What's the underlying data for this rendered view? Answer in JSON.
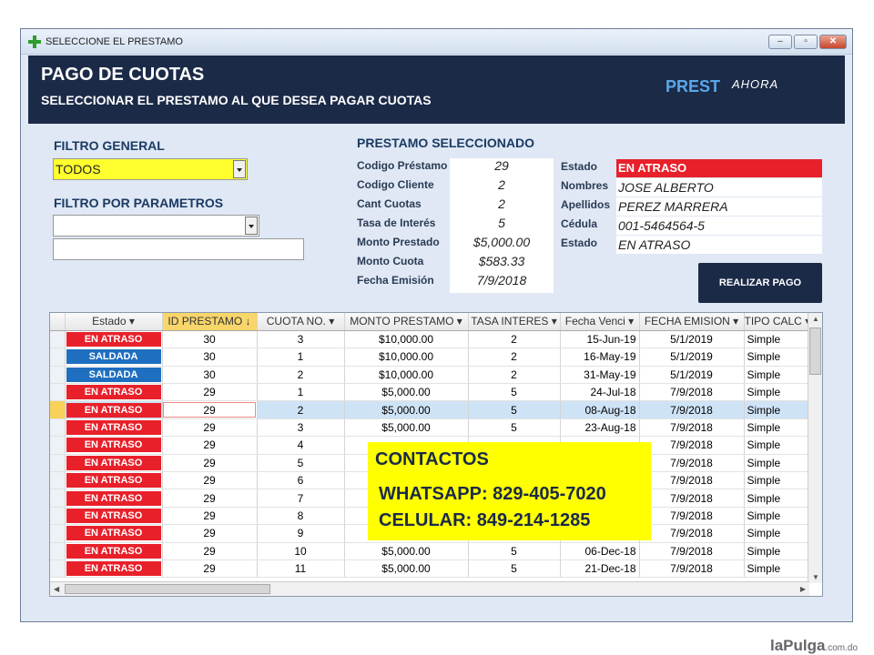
{
  "window": {
    "title": "SELECCIONE EL PRESTAMO",
    "minimize": "–",
    "maximize": "▫",
    "close": "✕"
  },
  "header": {
    "title": "PAGO DE CUOTAS",
    "subtitle": "SELECCIONAR EL PRESTAMO AL QUE DESEA PAGAR CUOTAS",
    "brand": "PREST",
    "brand_script": "AHORA"
  },
  "filters": {
    "general_label": "FILTRO GENERAL",
    "general_value": "TODOS",
    "param_label": "FILTRO POR PARAMETROS",
    "param_value": "",
    "param_text": ""
  },
  "selected": {
    "heading": "PRESTAMO SELECCIONADO",
    "fields": [
      {
        "label": "Codigo Préstamo",
        "value": "29"
      },
      {
        "label": "Codigo Cliente",
        "value": "2"
      },
      {
        "label": "Cant Cuotas",
        "value": "2"
      },
      {
        "label": "Tasa de Interés",
        "value": "5"
      },
      {
        "label": "Monto Prestado",
        "value": "$5,000.00"
      },
      {
        "label": "Monto Cuota",
        "value": "$583.33"
      },
      {
        "label": "Fecha Emisión",
        "value": "7/9/2018"
      }
    ],
    "info": [
      {
        "label": "Estado",
        "value": "EN ATRASO"
      },
      {
        "label": "Nombres",
        "value": "JOSE ALBERTO"
      },
      {
        "label": "Apellidos",
        "value": "PEREZ MARRERA"
      },
      {
        "label": "Cédula",
        "value": "001-5464564-5"
      },
      {
        "label": "Estado",
        "value": "EN ATRASO"
      }
    ]
  },
  "pay_button": "REALIZAR PAGO",
  "grid": {
    "columns": [
      "Estado",
      "ID PRESTAMO",
      "CUOTA NO.",
      "MONTO PRESTAMO",
      "TASA INTERES",
      "Fecha Venci",
      "FECHA EMISION",
      "TIPO CALC"
    ],
    "rows": [
      {
        "estado": "EN ATRASO",
        "id": "30",
        "cuota": "3",
        "monto": "$10,000.00",
        "tasa": "2",
        "venci": "15-Jun-19",
        "emision": "5/1/2019",
        "tipo": "Simple"
      },
      {
        "estado": "SALDADA",
        "id": "30",
        "cuota": "1",
        "monto": "$10,000.00",
        "tasa": "2",
        "venci": "16-May-19",
        "emision": "5/1/2019",
        "tipo": "Simple"
      },
      {
        "estado": "SALDADA",
        "id": "30",
        "cuota": "2",
        "monto": "$10,000.00",
        "tasa": "2",
        "venci": "31-May-19",
        "emision": "5/1/2019",
        "tipo": "Simple"
      },
      {
        "estado": "EN ATRASO",
        "id": "29",
        "cuota": "1",
        "monto": "$5,000.00",
        "tasa": "5",
        "venci": "24-Jul-18",
        "emision": "7/9/2018",
        "tipo": "Simple"
      },
      {
        "estado": "EN ATRASO",
        "id": "29",
        "cuota": "2",
        "monto": "$5,000.00",
        "tasa": "5",
        "venci": "08-Aug-18",
        "emision": "7/9/2018",
        "tipo": "Simple"
      },
      {
        "estado": "EN ATRASO",
        "id": "29",
        "cuota": "3",
        "monto": "$5,000.00",
        "tasa": "5",
        "venci": "23-Aug-18",
        "emision": "7/9/2018",
        "tipo": "Simple"
      },
      {
        "estado": "EN ATRASO",
        "id": "29",
        "cuota": "4",
        "monto": "",
        "tasa": "",
        "venci": "",
        "emision": "7/9/2018",
        "tipo": "Simple"
      },
      {
        "estado": "EN ATRASO",
        "id": "29",
        "cuota": "5",
        "monto": "",
        "tasa": "",
        "venci": "",
        "emision": "7/9/2018",
        "tipo": "Simple"
      },
      {
        "estado": "EN ATRASO",
        "id": "29",
        "cuota": "6",
        "monto": "",
        "tasa": "",
        "venci": "",
        "emision": "7/9/2018",
        "tipo": "Simple"
      },
      {
        "estado": "EN ATRASO",
        "id": "29",
        "cuota": "7",
        "monto": "",
        "tasa": "",
        "venci": "",
        "emision": "7/9/2018",
        "tipo": "Simple"
      },
      {
        "estado": "EN ATRASO",
        "id": "29",
        "cuota": "8",
        "monto": "",
        "tasa": "",
        "venci": "",
        "emision": "7/9/2018",
        "tipo": "Simple"
      },
      {
        "estado": "EN ATRASO",
        "id": "29",
        "cuota": "9",
        "monto": "",
        "tasa": "",
        "venci": "",
        "emision": "7/9/2018",
        "tipo": "Simple"
      },
      {
        "estado": "EN ATRASO",
        "id": "29",
        "cuota": "10",
        "monto": "$5,000.00",
        "tasa": "5",
        "venci": "06-Dec-18",
        "emision": "7/9/2018",
        "tipo": "Simple"
      },
      {
        "estado": "EN ATRASO",
        "id": "29",
        "cuota": "11",
        "monto": "$5,000.00",
        "tasa": "5",
        "venci": "21-Dec-18",
        "emision": "7/9/2018",
        "tipo": "Simple"
      }
    ]
  },
  "contact": {
    "title": "CONTACTOS",
    "whatsapp": "WHATSAPP: 829-405-7020",
    "celular": "CELULAR: 849-214-1285"
  },
  "watermark": {
    "brand": "laPulga",
    "domain": ".com.do"
  }
}
